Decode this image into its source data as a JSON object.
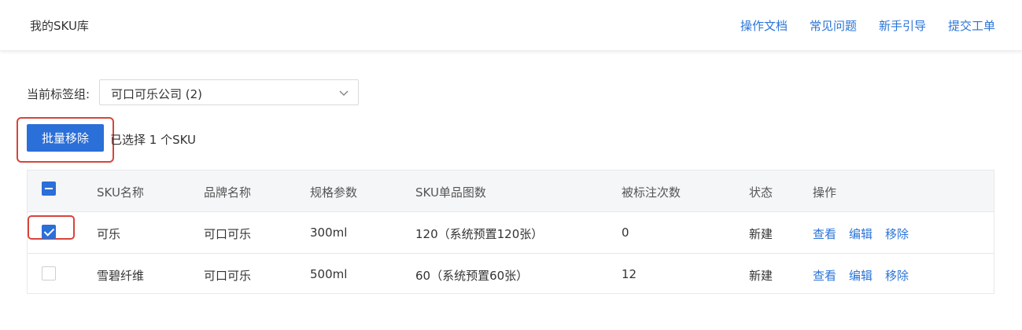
{
  "header": {
    "title": "我的SKU库",
    "links": [
      "操作文档",
      "常见问题",
      "新手引导",
      "提交工单"
    ]
  },
  "filter": {
    "label": "当前标签组:",
    "selected": "可口可乐公司 (2)"
  },
  "actions": {
    "batch_remove_label": "批量移除",
    "selected_text": "已选择 1 个SKU"
  },
  "table": {
    "columns": [
      "SKU名称",
      "品牌名称",
      "规格参数",
      "SKU单品图数",
      "被标注次数",
      "状态",
      "操作"
    ],
    "rows": [
      {
        "checked": true,
        "name": "可乐",
        "brand": "可口可乐",
        "spec": "300ml",
        "images": "120（系统预置120张）",
        "count": "0",
        "status": "新建",
        "ops": [
          "查看",
          "编辑",
          "移除"
        ]
      },
      {
        "checked": false,
        "name": "雪碧纤维",
        "brand": "可口可乐",
        "spec": "500ml",
        "images": "60（系统预置60张）",
        "count": "12",
        "status": "新建",
        "ops": [
          "查看",
          "编辑",
          "移除"
        ]
      }
    ]
  },
  "colors": {
    "primary": "#2b6fd8",
    "link": "#2b74d8",
    "highlight": "#d8443a"
  }
}
